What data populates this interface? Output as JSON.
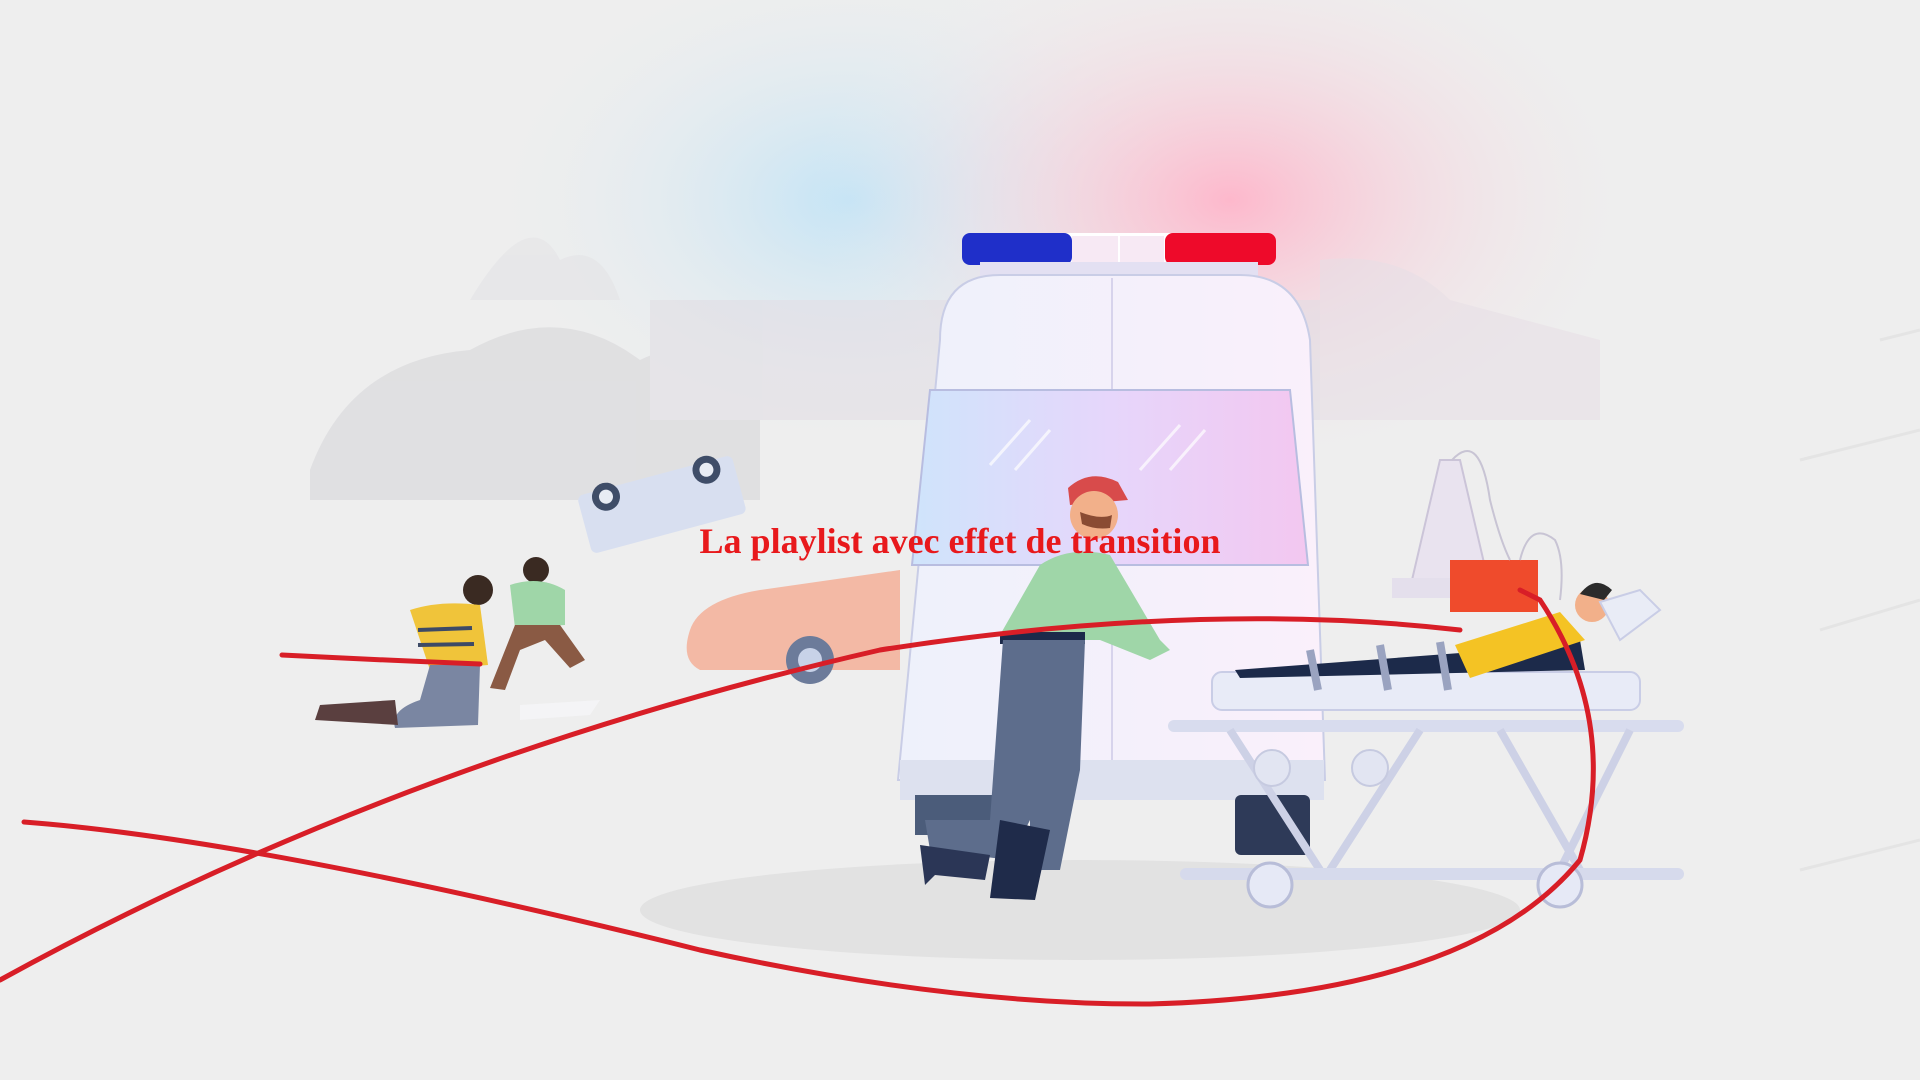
{
  "caption": "La playlist avec effet de transition",
  "colors": {
    "caption": "#e8191c",
    "ribbon": "#d81e27",
    "siren_blue": "#1f2fc9",
    "siren_red": "#ee0a2a",
    "background": "#eeeeee"
  },
  "icons": [
    "ambulance-illustration",
    "paramedic-figure",
    "patient-on-stretcher",
    "crashed-car",
    "rescuers-kneeling",
    "red-ribbon-line"
  ]
}
